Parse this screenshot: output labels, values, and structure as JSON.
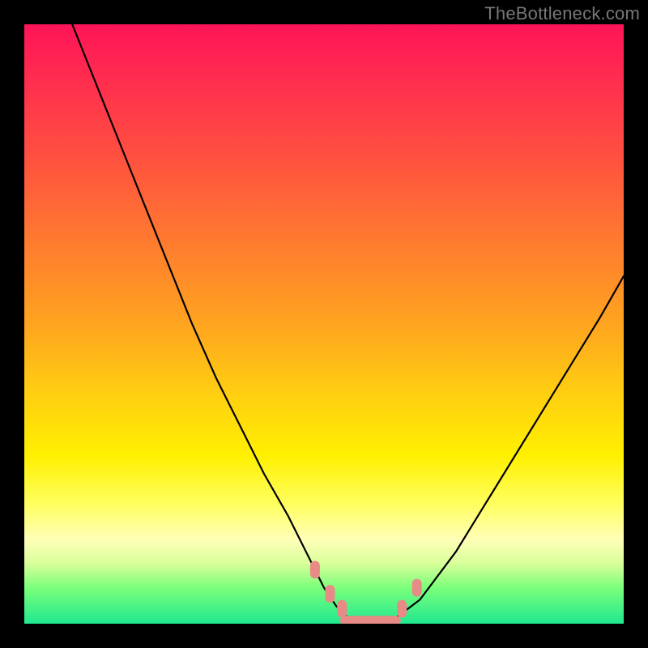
{
  "watermark": "TheBottleneck.com",
  "colors": {
    "frame": "#000000",
    "curve": "#000000",
    "marker": "#e88a86",
    "watermark": "#777777",
    "gradient_top": "#ff1458",
    "gradient_bottom": "#20e890"
  },
  "chart_data": {
    "type": "line",
    "title": "",
    "xlabel": "",
    "ylabel": "",
    "xlim": [
      0,
      100
    ],
    "ylim": [
      0,
      100
    ],
    "note": "Bottleneck-style V-curve. y≈0 (green) means balanced; y≈100 (red) means severe bottleneck. x is an unlabeled configuration axis. Values are estimated from pixel positions; the image has no numeric ticks.",
    "series": [
      {
        "name": "bottleneck-curve",
        "x": [
          8,
          12,
          16,
          20,
          24,
          28,
          32,
          36,
          40,
          44,
          48,
          50,
          52,
          54,
          56,
          58,
          60,
          62,
          66,
          72,
          80,
          88,
          96,
          100
        ],
        "y": [
          100,
          90,
          80,
          70,
          60,
          50,
          41,
          33,
          25,
          18,
          10,
          6,
          3,
          1,
          0,
          0,
          0,
          1,
          4,
          12,
          25,
          38,
          51,
          58
        ]
      }
    ],
    "markers": {
      "name": "highlighted-points",
      "color": "#e88a86",
      "x": [
        48.5,
        51,
        53,
        63,
        65.5
      ],
      "y": [
        9,
        5,
        2.5,
        2.5,
        6
      ]
    },
    "flat_segment": {
      "name": "minimum-band",
      "color": "#e88a86",
      "x": [
        53.5,
        62
      ],
      "y": [
        0.5,
        0.5
      ]
    }
  }
}
